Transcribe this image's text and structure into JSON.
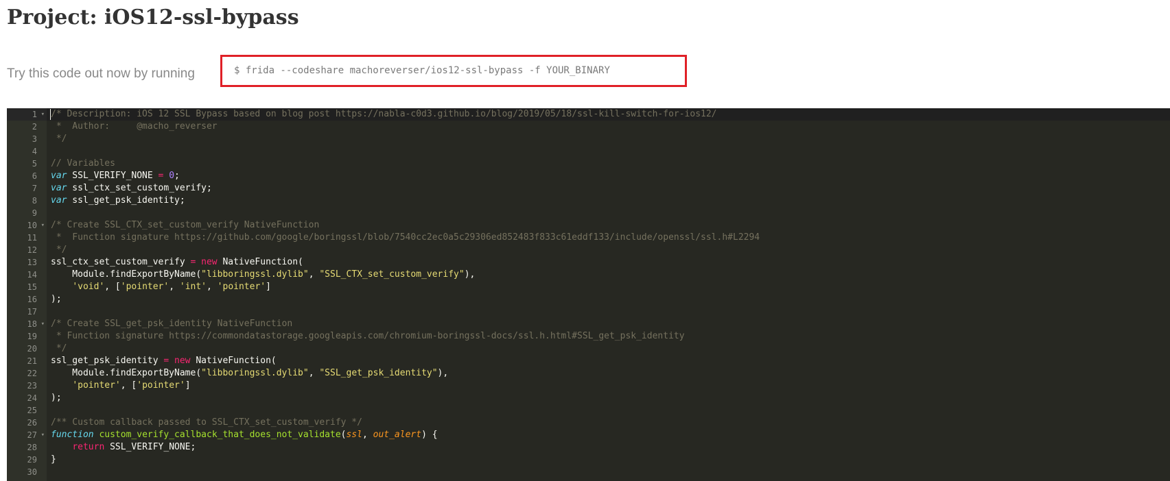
{
  "project": {
    "title": "Project: iOS12-ssl-bypass"
  },
  "try_it": {
    "label": "Try this code out now by running",
    "command": "$ frida --codeshare machoreverser/ios12-ssl-bypass -f YOUR_BINARY"
  },
  "editor": {
    "active_line": 1,
    "fold_lines": [
      1,
      10,
      18,
      27
    ],
    "lines": [
      {
        "n": "1",
        "tokens": [
          {
            "t": "comment",
            "v": "/* Description: iOS 12 SSL Bypass based on blog post https://nabla-c0d3.github.io/blog/2019/05/18/ssl-kill-switch-for-ios12/"
          }
        ]
      },
      {
        "n": "2",
        "tokens": [
          {
            "t": "comment",
            "v": " *  Author:     @macho_reverser"
          }
        ]
      },
      {
        "n": "3",
        "tokens": [
          {
            "t": "comment",
            "v": " */"
          }
        ]
      },
      {
        "n": "4",
        "tokens": []
      },
      {
        "n": "5",
        "tokens": [
          {
            "t": "comment",
            "v": "// Variables"
          }
        ]
      },
      {
        "n": "6",
        "tokens": [
          {
            "t": "keyword",
            "v": "var"
          },
          {
            "t": "plain",
            "v": " SSL_VERIFY_NONE "
          },
          {
            "t": "op",
            "v": "="
          },
          {
            "t": "plain",
            "v": " "
          },
          {
            "t": "num",
            "v": "0"
          },
          {
            "t": "plain",
            "v": ";"
          }
        ]
      },
      {
        "n": "7",
        "tokens": [
          {
            "t": "keyword",
            "v": "var"
          },
          {
            "t": "plain",
            "v": " ssl_ctx_set_custom_verify;"
          }
        ]
      },
      {
        "n": "8",
        "tokens": [
          {
            "t": "keyword",
            "v": "var"
          },
          {
            "t": "plain",
            "v": " ssl_get_psk_identity;"
          }
        ]
      },
      {
        "n": "9",
        "tokens": []
      },
      {
        "n": "10",
        "tokens": [
          {
            "t": "comment",
            "v": "/* Create SSL_CTX_set_custom_verify NativeFunction"
          }
        ]
      },
      {
        "n": "11",
        "tokens": [
          {
            "t": "comment",
            "v": " *  Function signature https://github.com/google/boringssl/blob/7540cc2ec0a5c29306ed852483f833c61eddf133/include/openssl/ssl.h#L2294"
          }
        ]
      },
      {
        "n": "12",
        "tokens": [
          {
            "t": "comment",
            "v": " */"
          }
        ]
      },
      {
        "n": "13",
        "tokens": [
          {
            "t": "plain",
            "v": "ssl_ctx_set_custom_verify "
          },
          {
            "t": "op",
            "v": "="
          },
          {
            "t": "plain",
            "v": " "
          },
          {
            "t": "new",
            "v": "new"
          },
          {
            "t": "plain",
            "v": " NativeFunction("
          }
        ]
      },
      {
        "n": "14",
        "tokens": [
          {
            "t": "plain",
            "v": "    Module.findExportByName("
          },
          {
            "t": "str",
            "v": "\"libboringssl.dylib\""
          },
          {
            "t": "plain",
            "v": ", "
          },
          {
            "t": "str",
            "v": "\"SSL_CTX_set_custom_verify\""
          },
          {
            "t": "plain",
            "v": "),"
          }
        ]
      },
      {
        "n": "15",
        "tokens": [
          {
            "t": "plain",
            "v": "    "
          },
          {
            "t": "str",
            "v": "'void'"
          },
          {
            "t": "plain",
            "v": ", ["
          },
          {
            "t": "str",
            "v": "'pointer'"
          },
          {
            "t": "plain",
            "v": ", "
          },
          {
            "t": "str",
            "v": "'int'"
          },
          {
            "t": "plain",
            "v": ", "
          },
          {
            "t": "str",
            "v": "'pointer'"
          },
          {
            "t": "plain",
            "v": "]"
          }
        ]
      },
      {
        "n": "16",
        "tokens": [
          {
            "t": "plain",
            "v": ");"
          }
        ]
      },
      {
        "n": "17",
        "tokens": []
      },
      {
        "n": "18",
        "tokens": [
          {
            "t": "comment",
            "v": "/* Create SSL_get_psk_identity NativeFunction"
          }
        ]
      },
      {
        "n": "19",
        "tokens": [
          {
            "t": "comment",
            "v": " * Function signature https://commondatastorage.googleapis.com/chromium-boringssl-docs/ssl.h.html#SSL_get_psk_identity"
          }
        ]
      },
      {
        "n": "20",
        "tokens": [
          {
            "t": "comment",
            "v": " */"
          }
        ]
      },
      {
        "n": "21",
        "tokens": [
          {
            "t": "plain",
            "v": "ssl_get_psk_identity "
          },
          {
            "t": "op",
            "v": "="
          },
          {
            "t": "plain",
            "v": " "
          },
          {
            "t": "new",
            "v": "new"
          },
          {
            "t": "plain",
            "v": " NativeFunction("
          }
        ]
      },
      {
        "n": "22",
        "tokens": [
          {
            "t": "plain",
            "v": "    Module.findExportByName("
          },
          {
            "t": "str",
            "v": "\"libboringssl.dylib\""
          },
          {
            "t": "plain",
            "v": ", "
          },
          {
            "t": "str",
            "v": "\"SSL_get_psk_identity\""
          },
          {
            "t": "plain",
            "v": "),"
          }
        ]
      },
      {
        "n": "23",
        "tokens": [
          {
            "t": "plain",
            "v": "    "
          },
          {
            "t": "str",
            "v": "'pointer'"
          },
          {
            "t": "plain",
            "v": ", ["
          },
          {
            "t": "str",
            "v": "'pointer'"
          },
          {
            "t": "plain",
            "v": "]"
          }
        ]
      },
      {
        "n": "24",
        "tokens": [
          {
            "t": "plain",
            "v": ");"
          }
        ]
      },
      {
        "n": "25",
        "tokens": []
      },
      {
        "n": "26",
        "tokens": [
          {
            "t": "comment",
            "v": "/** Custom callback passed to SSL_CTX_set_custom_verify */"
          }
        ]
      },
      {
        "n": "27",
        "tokens": [
          {
            "t": "keyword",
            "v": "function"
          },
          {
            "t": "plain",
            "v": " "
          },
          {
            "t": "fn",
            "v": "custom_verify_callback_that_does_not_validate"
          },
          {
            "t": "plain",
            "v": "("
          },
          {
            "t": "param",
            "v": "ssl"
          },
          {
            "t": "plain",
            "v": ", "
          },
          {
            "t": "param",
            "v": "out_alert"
          },
          {
            "t": "plain",
            "v": ") {"
          }
        ]
      },
      {
        "n": "28",
        "tokens": [
          {
            "t": "plain",
            "v": "    "
          },
          {
            "t": "new",
            "v": "return"
          },
          {
            "t": "plain",
            "v": " SSL_VERIFY_NONE;"
          }
        ]
      },
      {
        "n": "29",
        "tokens": [
          {
            "t": "plain",
            "v": "}"
          }
        ]
      },
      {
        "n": "30",
        "tokens": []
      }
    ]
  }
}
